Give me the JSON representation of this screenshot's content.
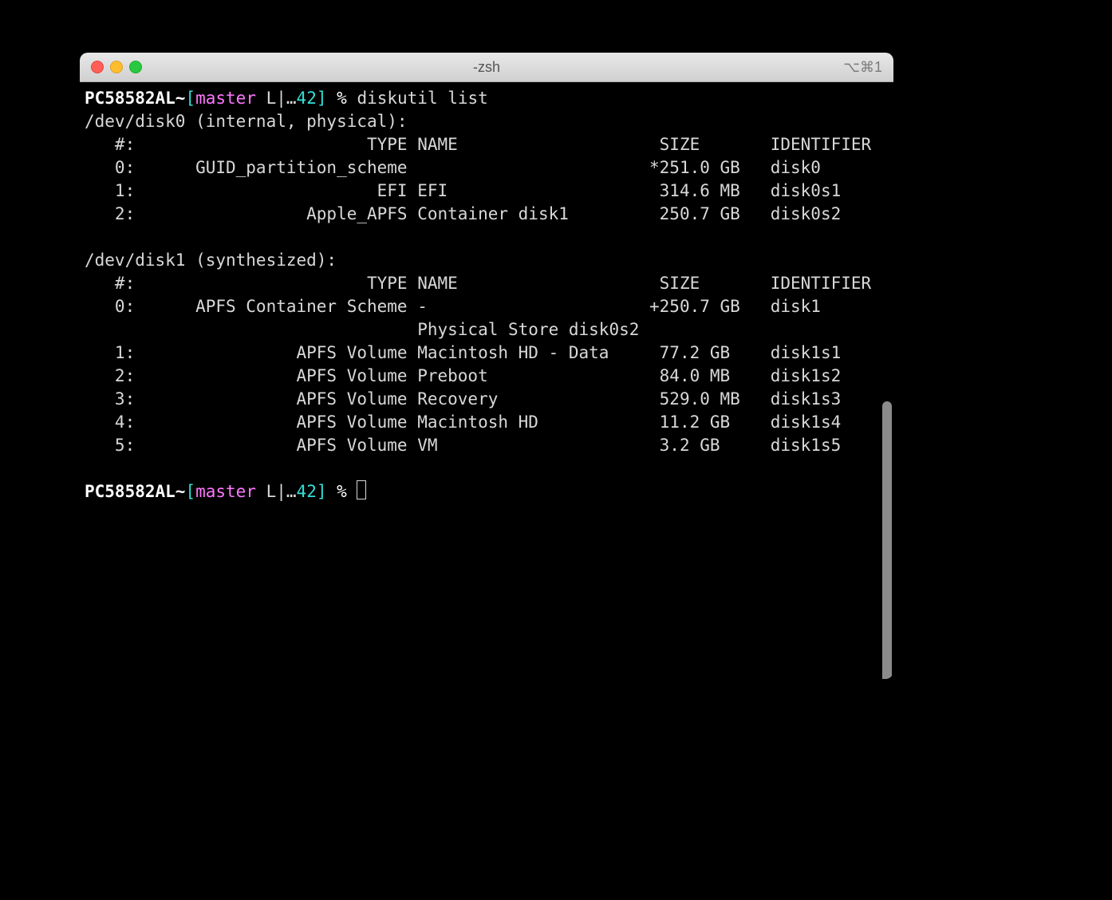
{
  "window": {
    "title": "-zsh",
    "shortcut_hint": "⌥⌘1"
  },
  "prompt": {
    "host": "PC58582AL",
    "separator": "~",
    "bracket_open": "[",
    "branch": "master",
    "git_status": " L|…",
    "git_num": "42",
    "bracket_close": "]",
    "symbol": " % "
  },
  "command": "diskutil list",
  "output": {
    "disk0": {
      "header": "/dev/disk0 (internal, physical):",
      "cols": "   #:                       TYPE NAME                    SIZE       IDENTIFIER",
      "rows": [
        "   0:      GUID_partition_scheme                        *251.0 GB   disk0",
        "   1:                        EFI EFI                     314.6 MB   disk0s1",
        "   2:                 Apple_APFS Container disk1         250.7 GB   disk0s2"
      ]
    },
    "disk1": {
      "header": "/dev/disk1 (synthesized):",
      "cols": "   #:                       TYPE NAME                    SIZE       IDENTIFIER",
      "rows": [
        "   0:      APFS Container Scheme -                      +250.7 GB   disk1",
        "                                 Physical Store disk0s2",
        "   1:                APFS Volume Macintosh HD - Data     77.2 GB    disk1s1",
        "   2:                APFS Volume Preboot                 84.0 MB    disk1s2",
        "   3:                APFS Volume Recovery                529.0 MB   disk1s3",
        "   4:                APFS Volume Macintosh HD            11.2 GB    disk1s4",
        "   5:                APFS Volume VM                      3.2 GB     disk1s5"
      ]
    }
  }
}
